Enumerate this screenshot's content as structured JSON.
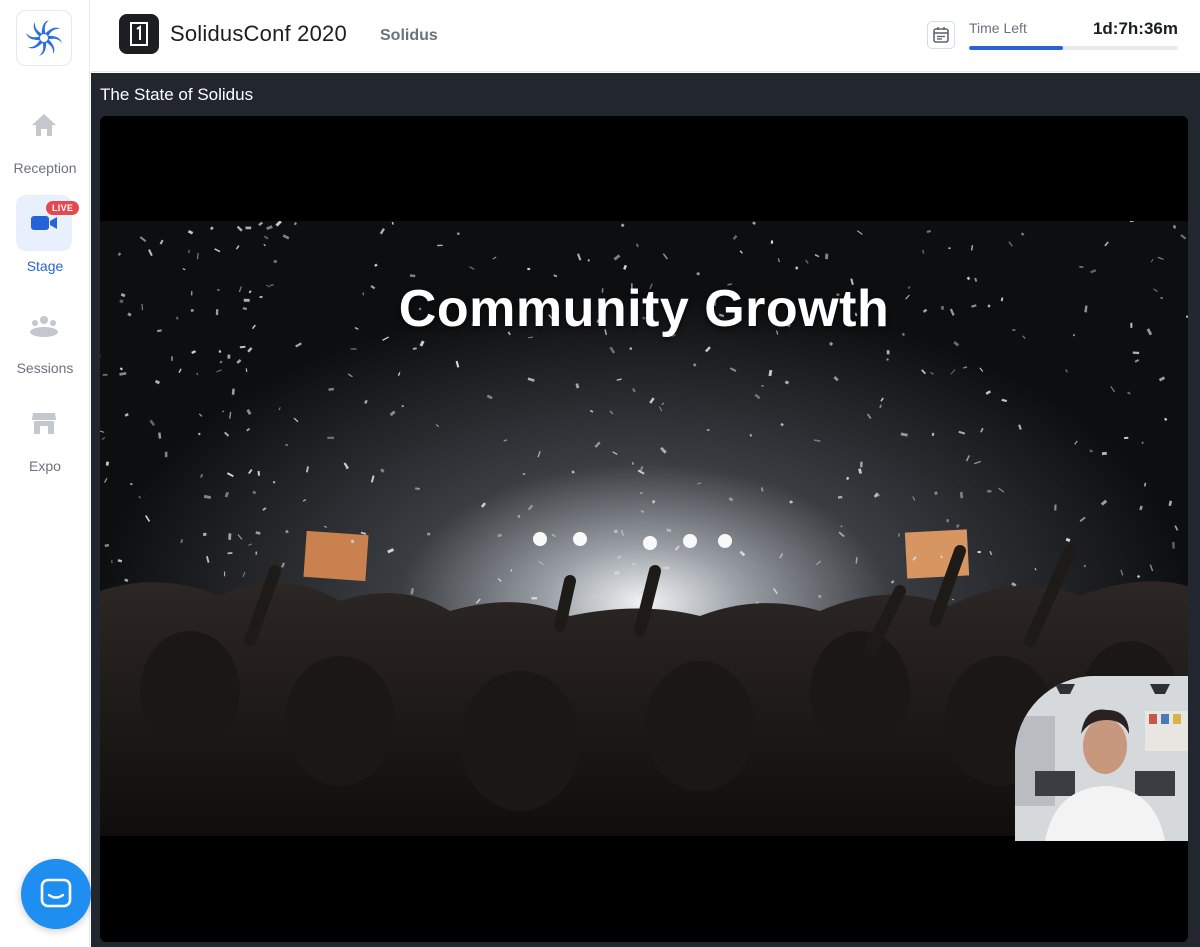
{
  "sidebar": {
    "items": [
      {
        "label": "Reception",
        "icon": "home-icon",
        "active": false
      },
      {
        "label": "Stage",
        "icon": "video-camera-icon",
        "active": true,
        "badge": "LIVE"
      },
      {
        "label": "Sessions",
        "icon": "group-icon",
        "active": false
      },
      {
        "label": "Expo",
        "icon": "storefront-icon",
        "active": false
      }
    ]
  },
  "header": {
    "event_title": "SolidusConf 2020",
    "org_name": "Solidus",
    "time_left_label": "Time Left",
    "time_left_value": "1d:7h:36m",
    "time_progress": 0.45
  },
  "stage": {
    "session_title": "The State of Solidus",
    "slide_heading": "Community Growth"
  },
  "colors": {
    "accent": "#2563d8",
    "live_badge": "#e5484d",
    "chat_button": "#1f8ef1",
    "stage_bg": "#22262e"
  }
}
